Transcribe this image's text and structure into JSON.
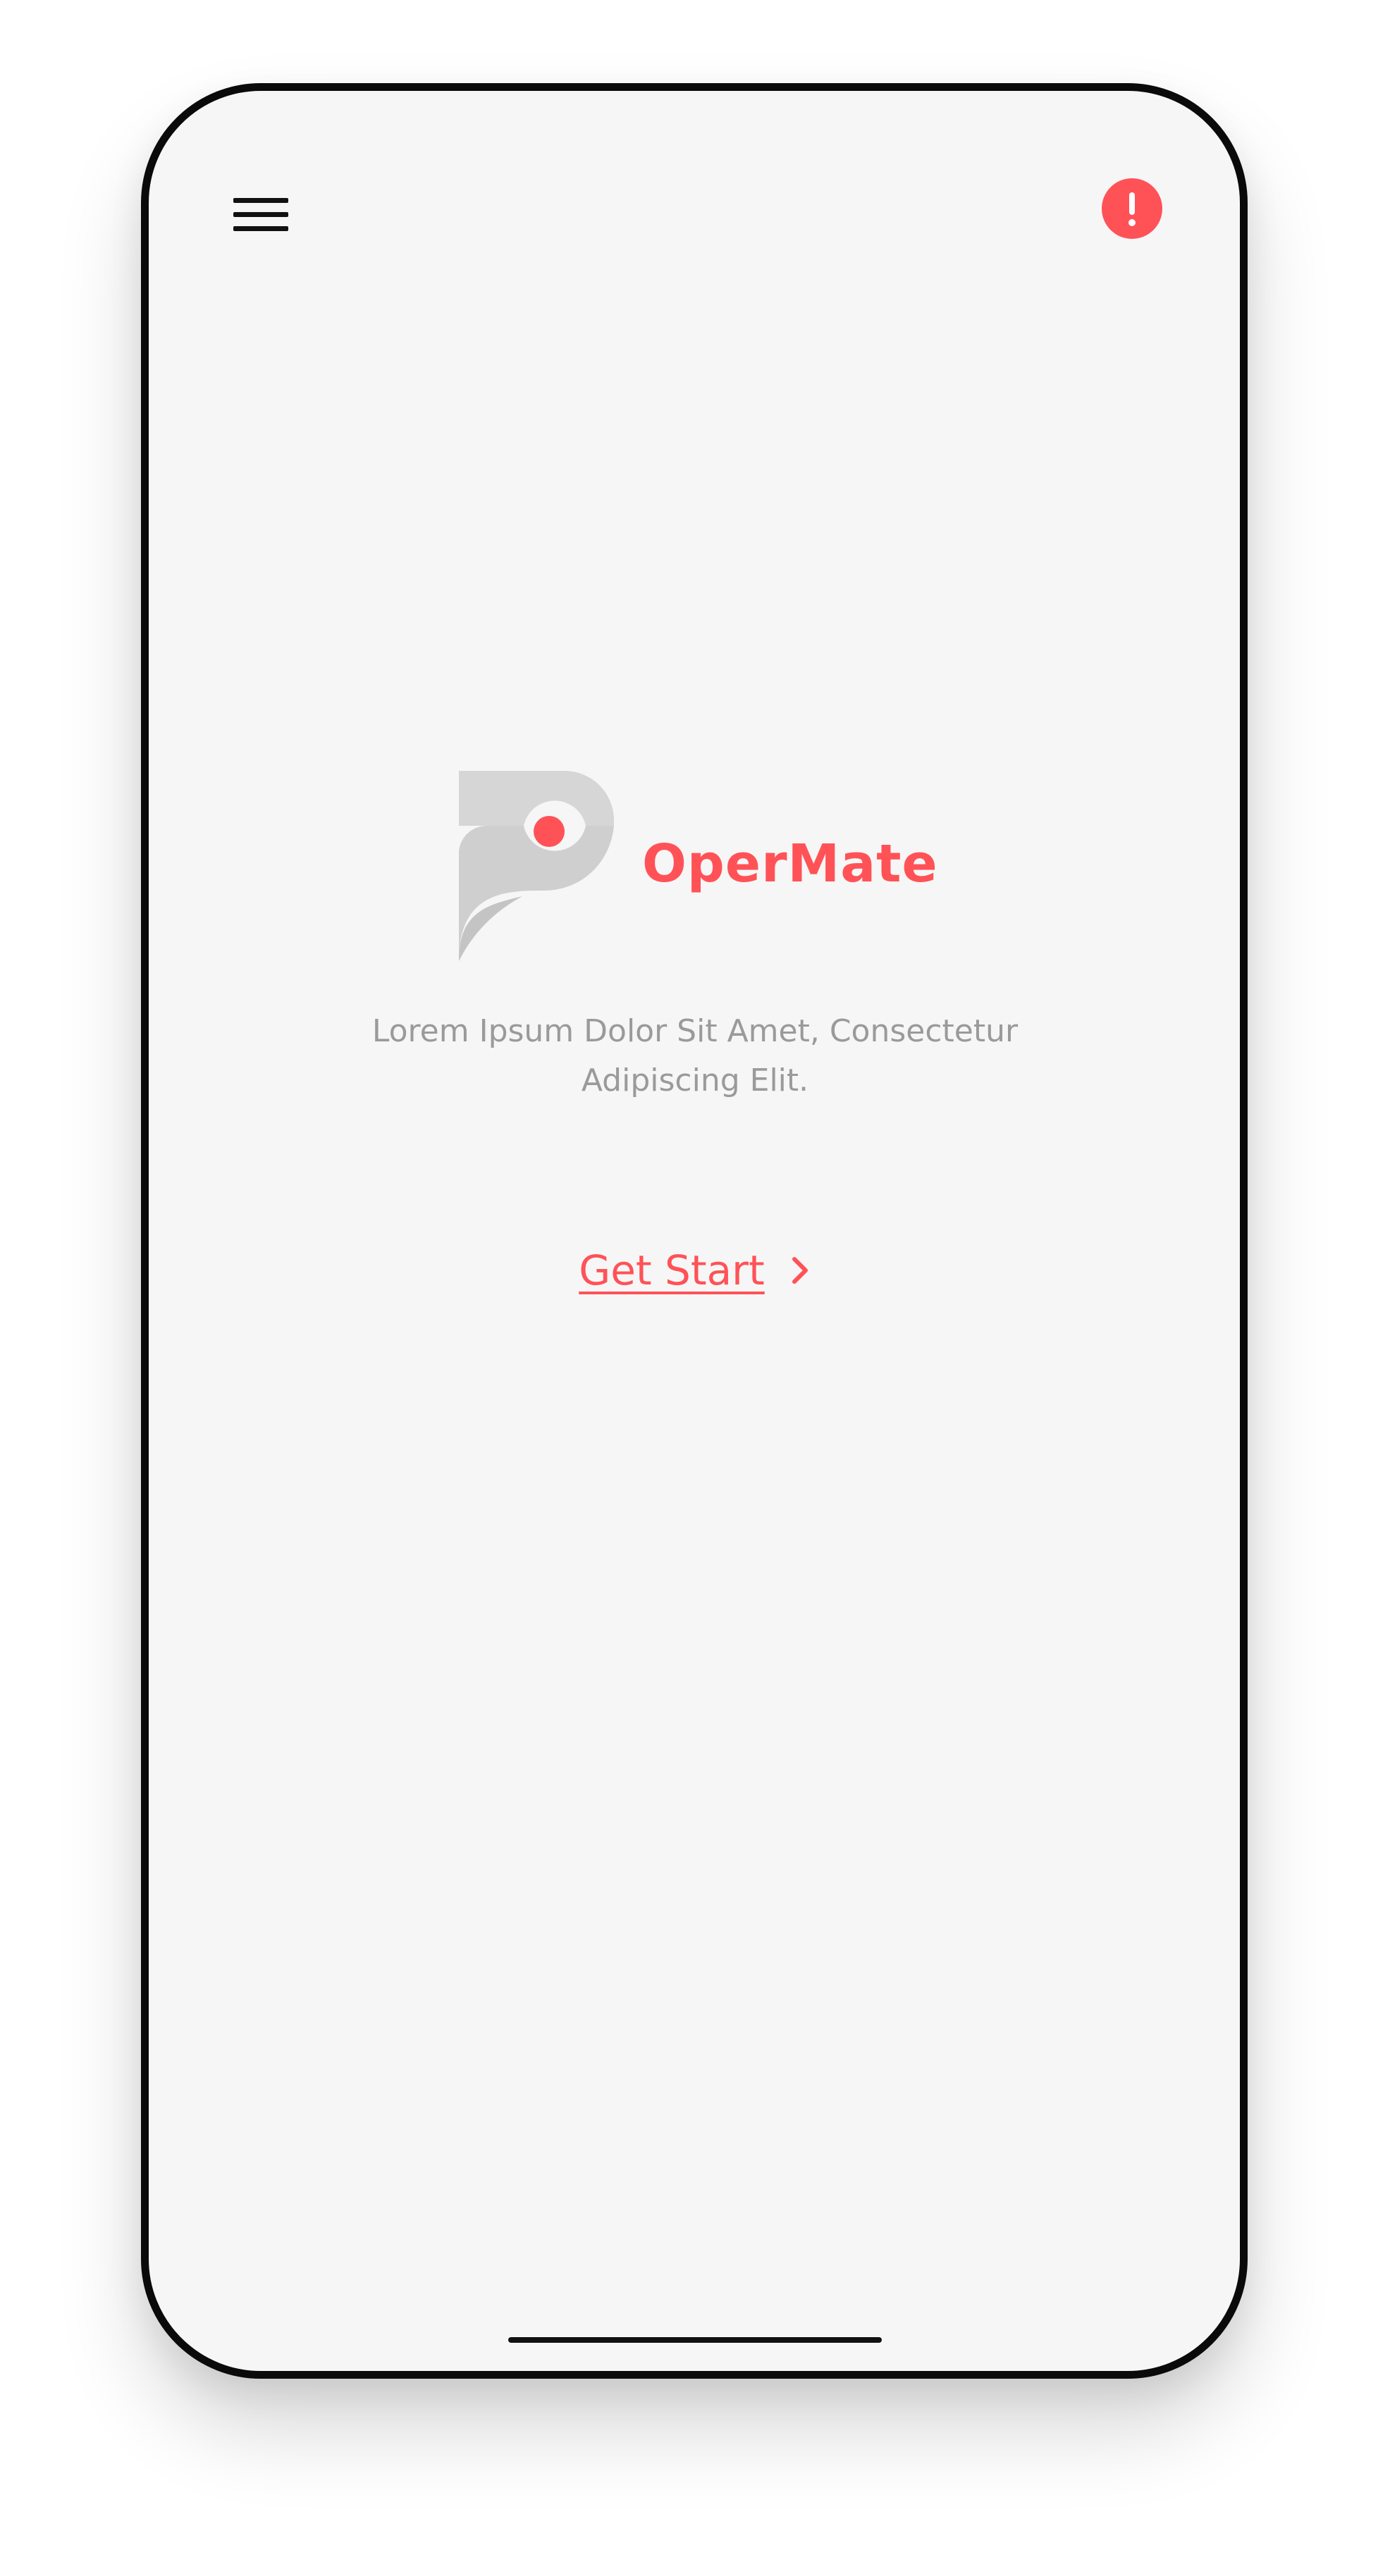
{
  "app": {
    "brand_name": "OperMate",
    "tagline_line1": "Lorem Ipsum Dolor Sit Amet, Consectetur",
    "tagline_line2": "Adipiscing Elit.",
    "cta_label": "Get Start"
  },
  "header": {
    "menu_icon": "hamburger-menu-icon",
    "alert_icon": "exclamation-circle-icon",
    "alert_symbol": "!"
  },
  "colors": {
    "accent": "#ff5257",
    "logo_gray": "#d2d2d2",
    "text_gray": "#9a9a9a",
    "background": "#f6f6f6",
    "frame": "#0a0a0a"
  }
}
